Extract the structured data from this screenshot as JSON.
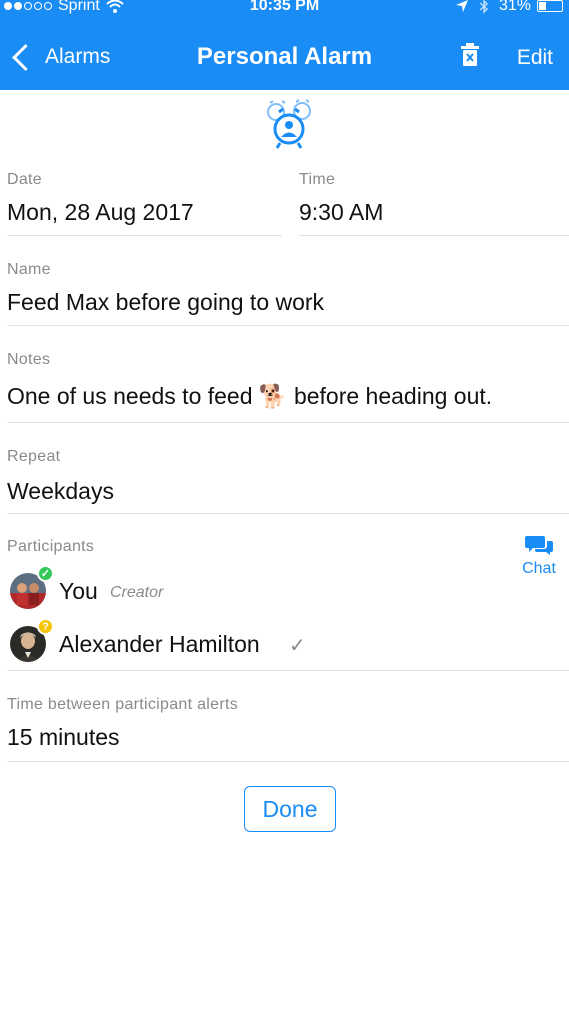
{
  "status_bar": {
    "carrier": "Sprint",
    "time": "10:35 PM",
    "battery": "31%",
    "battery_level": 0.31,
    "signal_bars_filled": 2,
    "signal_bars_total": 5,
    "icons": [
      "wifi-icon",
      "location-arrow-icon",
      "bluetooth-icon",
      "battery-icon"
    ]
  },
  "nav": {
    "back_label": "Alarms",
    "title": "Personal Alarm",
    "edit_label": "Edit",
    "accent_color": "#1a8cf5"
  },
  "fields": {
    "date": {
      "label": "Date",
      "value": "Mon, 28 Aug 2017"
    },
    "time": {
      "label": "Time",
      "value": "9:30 AM"
    },
    "name": {
      "label": "Name",
      "value": "Feed Max before going to work"
    },
    "notes": {
      "label": "Notes",
      "value_before": "One of us needs to feed",
      "emoji": "🐕",
      "value_after": "before heading out."
    },
    "repeat": {
      "label": "Repeat",
      "value": "Weekdays"
    },
    "participants": {
      "label": "Participants",
      "chat_label": "Chat",
      "items": [
        {
          "name": "You",
          "role": "Creator",
          "status": "accepted",
          "badge_color": "#34c759"
        },
        {
          "name": "Alexander Hamilton",
          "role": "",
          "status": "pending",
          "badge_color": "#f5c400",
          "badge_text": "?",
          "check": "✓"
        }
      ]
    },
    "interval": {
      "label": "Time between participant alerts",
      "value": "15 minutes"
    }
  },
  "done_label": "Done"
}
